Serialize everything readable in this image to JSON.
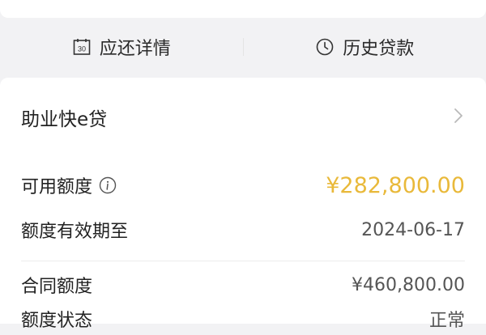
{
  "tabs": {
    "repayment": {
      "label": "应还详情",
      "icon": "calendar-icon",
      "icon_text": "30"
    },
    "history": {
      "label": "历史贷款",
      "icon": "clock-icon"
    }
  },
  "product": {
    "name": "助业快e贷",
    "icon": "chevron-right-icon"
  },
  "details": {
    "available_label": "可用额度",
    "available_value": "¥282,800.00",
    "valid_until_label": "额度有效期至",
    "valid_until_value": "2024-06-17",
    "contract_label": "合同额度",
    "contract_value": "¥460,800.00",
    "status_label": "额度状态",
    "status_value": "正常"
  },
  "colors": {
    "accent": "#e9b93a",
    "background": "#f2f2f4",
    "card": "#ffffff"
  }
}
